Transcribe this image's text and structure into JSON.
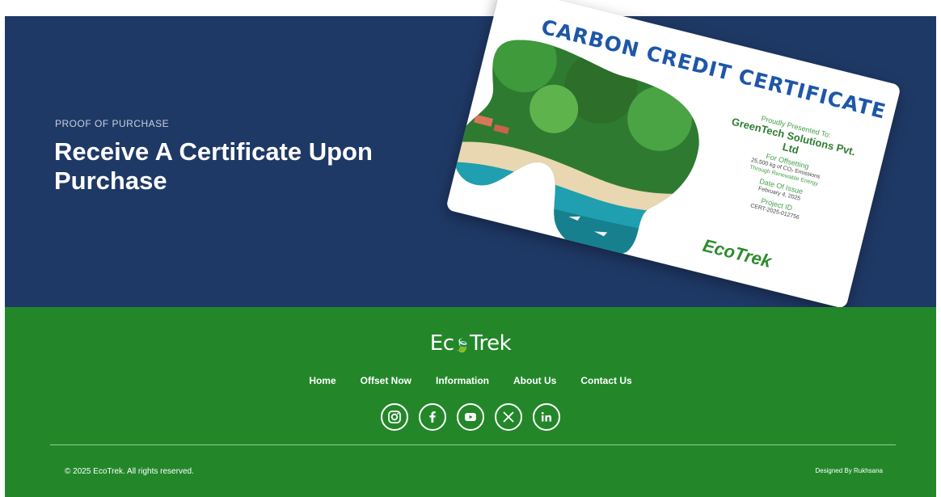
{
  "hero": {
    "eyebrow": "PROOF OF PURCHASE",
    "title": "Receive A Certificate Upon Purchase"
  },
  "certificate": {
    "title": "CARBON CREDIT CERTIFICATE",
    "presented_label": "Proudly Presented To:",
    "company": "GreenTech Solutions Pvt. Ltd",
    "offsetting_label": "For Offsetting",
    "offsetting_value": "25,500 kg of CO₂ Emissions",
    "offsetting_sub": "Through Renewable Energy",
    "date_label": "Date Of Issue",
    "date_value": "February 4, 2025",
    "project_label": "Project ID",
    "project_value": "CERT-2025-012756",
    "logo_text": "EcoTrek"
  },
  "footer": {
    "brand_left": "Ec",
    "brand_right": "Trek",
    "nav": [
      "Home",
      "Offset Now",
      "Information",
      "About Us",
      "Contact Us"
    ],
    "socials": [
      "instagram-icon",
      "facebook-icon",
      "youtube-icon",
      "x-icon",
      "linkedin-icon"
    ],
    "copyright": "© 2025 EcoTrek. All rights reserved.",
    "designed_by": "Designed By Rukhsana"
  },
  "colors": {
    "hero_bg": "#1f3966",
    "footer_bg": "#23872a",
    "cert_title": "#1e57a8",
    "cert_green": "#2e7d32"
  }
}
